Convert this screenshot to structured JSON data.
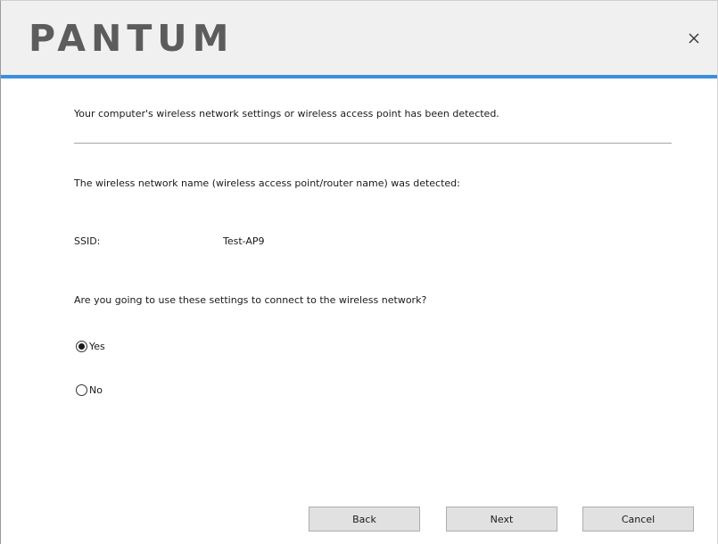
{
  "header": {
    "logo_text": "PANTUM",
    "close_glyph": "×",
    "accent_color": "#3d8fdb"
  },
  "main": {
    "detected_message": "Your computer's wireless network settings or wireless access point has been detected.",
    "ssid_intro": "The wireless network name (wireless access point/router name) was detected:",
    "ssid_label": "SSID:",
    "ssid_value": "Test-AP9",
    "question": "Are you going to use these settings to connect to the wireless network?",
    "options": [
      {
        "label": "Yes",
        "selected": true
      },
      {
        "label": "No",
        "selected": false
      }
    ]
  },
  "footer": {
    "back_label": "Back",
    "next_label": "Next",
    "cancel_label": "Cancel"
  }
}
